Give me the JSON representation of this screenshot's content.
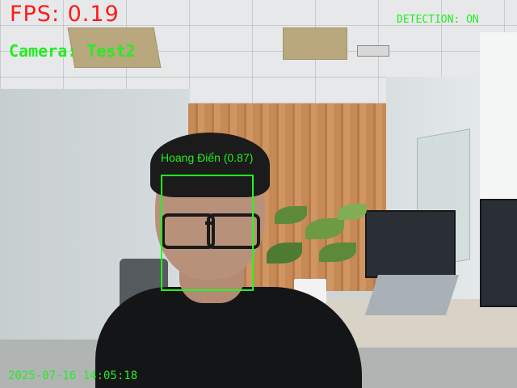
{
  "overlay": {
    "fps_text": "FPS: 0.19",
    "camera_text": "Camera: Test2",
    "detection_status": "DETECTION: ON",
    "timestamp": "2025-07-16 14:05:18"
  },
  "detections": [
    {
      "label": "Hoang Điển (0.87)"
    }
  ],
  "colors": {
    "fps": "#ff1a1a",
    "overlay_text": "#22ee22",
    "face_box": "#1eff1e"
  }
}
